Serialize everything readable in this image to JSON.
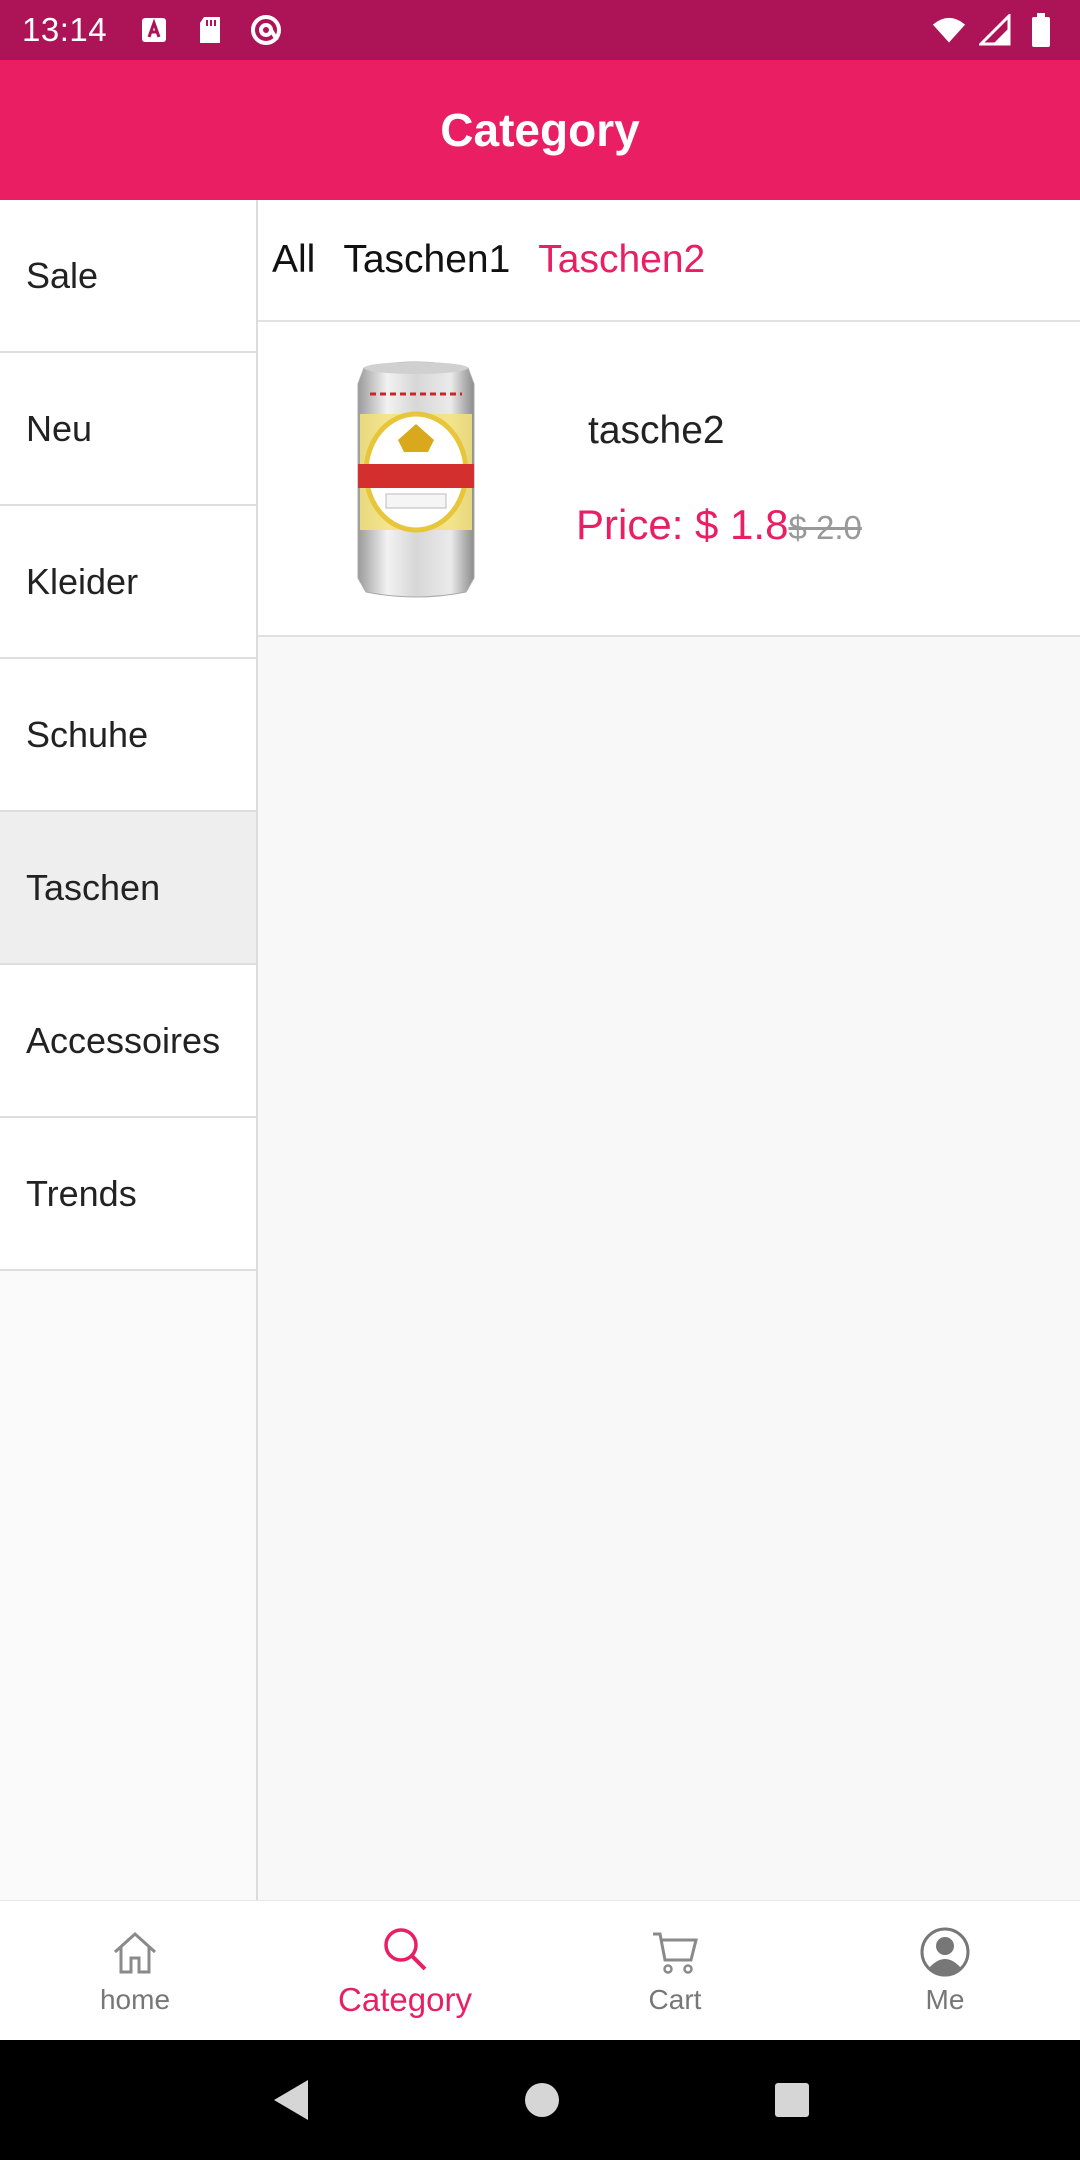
{
  "status_bar": {
    "time": "13:14",
    "icons_left": [
      "a-box-icon",
      "sd-card-icon",
      "at-sign-icon"
    ],
    "icons_right": [
      "wifi-icon",
      "signal-icon",
      "battery-icon"
    ]
  },
  "app_bar": {
    "title": "Category"
  },
  "sidebar": {
    "items": [
      {
        "label": "Sale"
      },
      {
        "label": "Neu"
      },
      {
        "label": "Kleider"
      },
      {
        "label": "Schuhe"
      },
      {
        "label": "Taschen"
      },
      {
        "label": "Accessoires"
      },
      {
        "label": "Trends"
      }
    ],
    "active_index": 4
  },
  "subcategories": {
    "items": [
      {
        "label": "All"
      },
      {
        "label": "Taschen1"
      },
      {
        "label": "Taschen2"
      }
    ],
    "active_index": 2
  },
  "products": [
    {
      "name": "tasche2",
      "price": "Price: $ 1.8",
      "old_price": "$ 2.0",
      "image": "beer-can-image"
    }
  ],
  "bottom_nav": {
    "items": [
      {
        "label": "home",
        "icon": "home-icon"
      },
      {
        "label": "Category",
        "icon": "search-icon"
      },
      {
        "label": "Cart",
        "icon": "cart-icon"
      },
      {
        "label": "Me",
        "icon": "person-icon"
      }
    ],
    "active_index": 1
  },
  "colors": {
    "status_bar": "#ad1457",
    "primary": "#e91e63",
    "inactive_nav": "#777777"
  }
}
